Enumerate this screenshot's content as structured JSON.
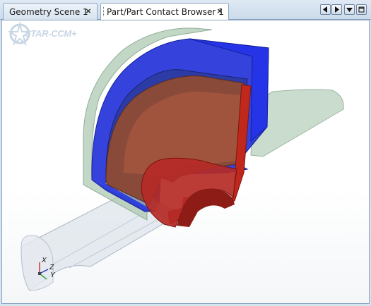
{
  "tabs": [
    {
      "label": "Geometry Scene 1",
      "close": "×",
      "active": false
    },
    {
      "label": "Part/Part Contact Browser 1",
      "close": "×",
      "active": true
    }
  ],
  "nav": {
    "prev_icon": "triangle-left-icon",
    "next_icon": "triangle-right-icon",
    "menu_icon": "triangle-down-icon",
    "restore_icon": "restore-window-icon"
  },
  "viewport": {
    "watermark": "STAR-CCM+",
    "triad": {
      "x": "X",
      "y": "Y",
      "z": "Z"
    }
  },
  "colors": {
    "active_tab": "#ffffff",
    "blue_part": "#1f2fd8",
    "red_part": "#c0281c",
    "translucent_part": "#9fbfa6"
  }
}
